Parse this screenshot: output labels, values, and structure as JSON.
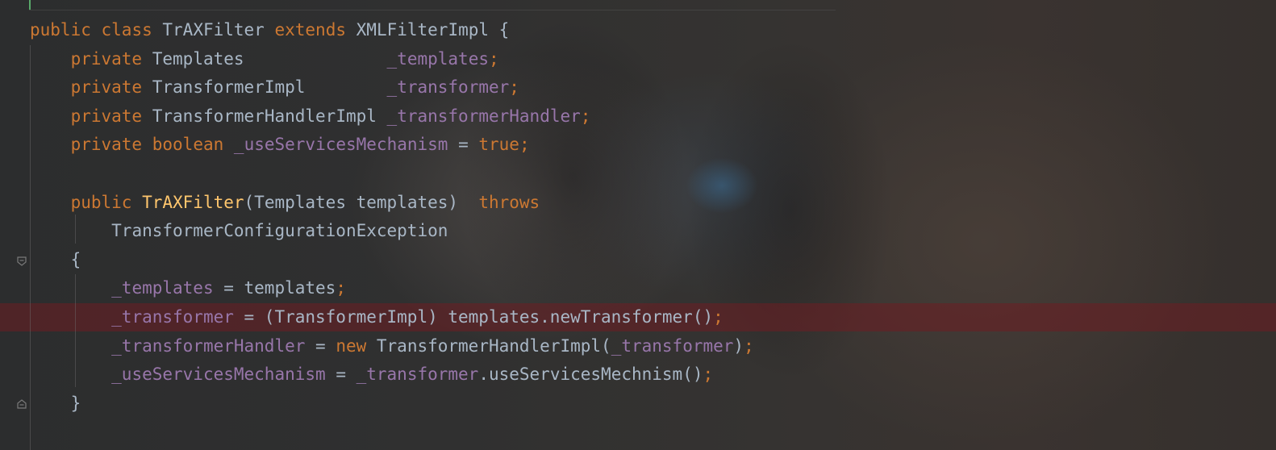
{
  "editor": {
    "colors": {
      "keyword": "#cc7832",
      "field": "#9876aa",
      "method": "#ffc66d",
      "default": "#a9b7c6",
      "breakpoint_line": "#6e1e22"
    },
    "lines": [
      {
        "tokens": [
          [
            "kw",
            "public"
          ],
          [
            "sp",
            " "
          ],
          [
            "kw",
            "class"
          ],
          [
            "sp",
            " "
          ],
          [
            "type",
            "TrAXFilter"
          ],
          [
            "sp",
            " "
          ],
          [
            "kw",
            "extends"
          ],
          [
            "sp",
            " "
          ],
          [
            "type",
            "XMLFilterImpl {"
          ]
        ]
      },
      {
        "tokens": [
          [
            "sp",
            "    "
          ],
          [
            "kw",
            "private"
          ],
          [
            "sp",
            " "
          ],
          [
            "type",
            "Templates              "
          ],
          [
            "field",
            "_templates"
          ],
          [
            "punct",
            ";"
          ]
        ]
      },
      {
        "tokens": [
          [
            "sp",
            "    "
          ],
          [
            "kw",
            "private"
          ],
          [
            "sp",
            " "
          ],
          [
            "type",
            "TransformerImpl        "
          ],
          [
            "field",
            "_transformer"
          ],
          [
            "punct",
            ";"
          ]
        ]
      },
      {
        "tokens": [
          [
            "sp",
            "    "
          ],
          [
            "kw",
            "private"
          ],
          [
            "sp",
            " "
          ],
          [
            "type",
            "TransformerHandlerImpl "
          ],
          [
            "field",
            "_transformerHandler"
          ],
          [
            "punct",
            ";"
          ]
        ]
      },
      {
        "tokens": [
          [
            "sp",
            "    "
          ],
          [
            "kw",
            "private"
          ],
          [
            "sp",
            " "
          ],
          [
            "kw",
            "boolean"
          ],
          [
            "sp",
            " "
          ],
          [
            "field",
            "_useServicesMechanism"
          ],
          [
            "type",
            " = "
          ],
          [
            "kw",
            "true"
          ],
          [
            "punct",
            ";"
          ]
        ]
      },
      {
        "tokens": [
          [
            "sp",
            ""
          ]
        ]
      },
      {
        "tokens": [
          [
            "sp",
            "    "
          ],
          [
            "kw",
            "public"
          ],
          [
            "sp",
            " "
          ],
          [
            "method",
            "TrAXFilter"
          ],
          [
            "type",
            "(Templates templates)  "
          ],
          [
            "kw",
            "throws"
          ]
        ]
      },
      {
        "tokens": [
          [
            "sp",
            "        "
          ],
          [
            "type",
            "TransformerConfigurationException"
          ]
        ]
      },
      {
        "tokens": [
          [
            "sp",
            "    "
          ],
          [
            "type",
            "{"
          ]
        ]
      },
      {
        "tokens": [
          [
            "sp",
            "        "
          ],
          [
            "field",
            "_templates"
          ],
          [
            "type",
            " = templates"
          ],
          [
            "punct",
            ";"
          ]
        ]
      },
      {
        "tokens": [
          [
            "sp",
            "        "
          ],
          [
            "field",
            "_transformer"
          ],
          [
            "type",
            " = (TransformerImpl) templates.newTransformer()"
          ],
          [
            "punct",
            ";"
          ]
        ],
        "breakpoint": true
      },
      {
        "tokens": [
          [
            "sp",
            "        "
          ],
          [
            "field",
            "_transformerHandler"
          ],
          [
            "type",
            " = "
          ],
          [
            "kw",
            "new"
          ],
          [
            "type",
            " TransformerHandlerImpl("
          ],
          [
            "field",
            "_transformer"
          ],
          [
            "type",
            ")"
          ],
          [
            "punct",
            ";"
          ]
        ]
      },
      {
        "tokens": [
          [
            "sp",
            "        "
          ],
          [
            "field",
            "_useServicesMechanism"
          ],
          [
            "type",
            " = "
          ],
          [
            "field",
            "_transformer"
          ],
          [
            "type",
            ".useServicesMechnism()"
          ],
          [
            "punct",
            ";"
          ]
        ]
      },
      {
        "tokens": [
          [
            "sp",
            "    "
          ],
          [
            "type",
            "}"
          ]
        ]
      }
    ]
  }
}
